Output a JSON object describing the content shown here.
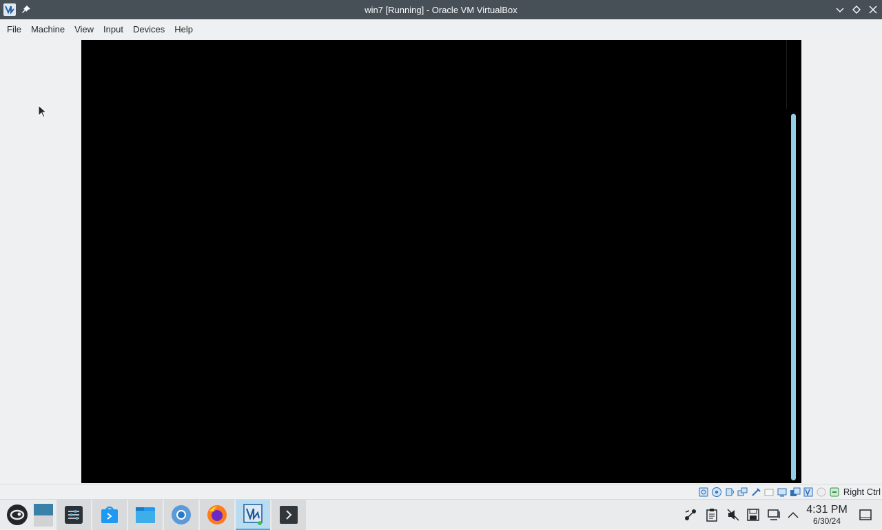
{
  "window": {
    "title": "win7 [Running] - Oracle VM VirtualBox",
    "icons": [
      "virtualbox-app-icon",
      "pin-icon",
      "minimize-icon",
      "maximize-icon",
      "close-icon"
    ]
  },
  "menu": {
    "file": "File",
    "machine": "Machine",
    "view": "View",
    "input": "Input",
    "devices": "Devices",
    "help": "Help"
  },
  "statusbar": {
    "icons": [
      "hard-disk-icon",
      "optical-drive-icon",
      "audio-icon",
      "network-icon",
      "usb-icon",
      "shared-folders-icon",
      "display-icon",
      "video-capture-icon",
      "vt-x-icon",
      "mouse-integration-icon",
      "keyboard-capture-icon"
    ],
    "host_key": "Right Ctrl"
  },
  "taskbar": {
    "apps": [
      "opensuse-launcher-icon",
      "pager-icon",
      "system-settings-icon",
      "discover-icon",
      "dolphin-file-manager-icon",
      "chromium-icon",
      "firefox-icon",
      "virtualbox-icon",
      "konsole-icon"
    ],
    "tray_icons": [
      "kde-connect-icon",
      "clipboard-icon",
      "volume-muted-icon",
      "save-icon",
      "network-icon",
      "tray-expand-icon",
      "show-desktop-icon"
    ],
    "clock": {
      "time": "4:31 PM",
      "date": "6/30/24"
    }
  },
  "colors": {
    "titlebar": "#475057",
    "accent": "#3daee9",
    "vm_screen": "#000000"
  }
}
